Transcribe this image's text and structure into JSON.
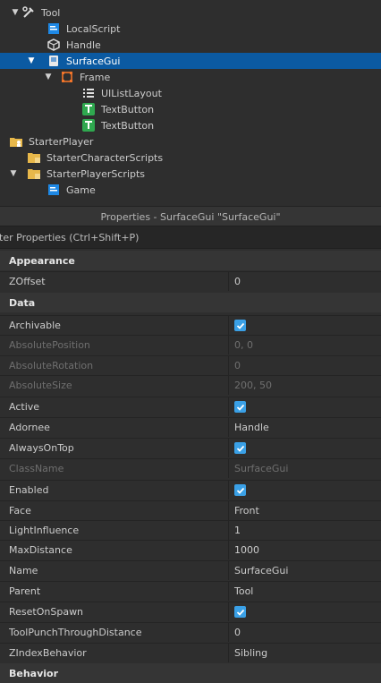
{
  "explorer": {
    "items": [
      {
        "label": "Tool",
        "icon": "tool-icon",
        "expanded": true
      },
      {
        "label": "LocalScript",
        "icon": "localscript-icon"
      },
      {
        "label": "Handle",
        "icon": "part-icon"
      },
      {
        "label": "SurfaceGui",
        "icon": "surfacegui-icon",
        "expanded": true,
        "selected": true
      },
      {
        "label": "Frame",
        "icon": "frame-icon",
        "expanded": true
      },
      {
        "label": "UIListLayout",
        "icon": "list-layout-icon"
      },
      {
        "label": "TextButton",
        "icon": "textbutton-icon"
      },
      {
        "label": "TextButton",
        "icon": "textbutton-icon"
      },
      {
        "label": "StarterPlayer",
        "icon": "starterplayer-icon"
      },
      {
        "label": "StarterCharacterScripts",
        "icon": "folder-icon"
      },
      {
        "label": "StarterPlayerScripts",
        "icon": "folder-icon",
        "expanded": true
      },
      {
        "label": "Game",
        "icon": "localscript-icon"
      }
    ]
  },
  "properties": {
    "title": "Properties - SurfaceGui \"SurfaceGui\"",
    "filter_placeholder": "lter Properties (Ctrl+Shift+P)",
    "sections": [
      {
        "name": "Appearance"
      },
      {
        "name": "Data"
      },
      {
        "name": "Behavior"
      }
    ],
    "rows": [
      {
        "name": "ZOffset",
        "value": "0"
      },
      {
        "name": "Archivable",
        "checked": true
      },
      {
        "name": "AbsolutePosition",
        "value": "0, 0",
        "disabled": true
      },
      {
        "name": "AbsoluteRotation",
        "value": "0",
        "disabled": true
      },
      {
        "name": "AbsoluteSize",
        "value": "200, 50",
        "disabled": true
      },
      {
        "name": "Active",
        "checked": true
      },
      {
        "name": "Adornee",
        "value": "Handle"
      },
      {
        "name": "AlwaysOnTop",
        "checked": true
      },
      {
        "name": "ClassName",
        "value": "SurfaceGui",
        "disabled": true
      },
      {
        "name": "Enabled",
        "checked": true
      },
      {
        "name": "Face",
        "value": "Front"
      },
      {
        "name": "LightInfluence",
        "value": "1"
      },
      {
        "name": "MaxDistance",
        "value": "1000"
      },
      {
        "name": "Name",
        "value": "SurfaceGui"
      },
      {
        "name": "Parent",
        "value": "Tool"
      },
      {
        "name": "ResetOnSpawn",
        "checked": true
      },
      {
        "name": "ToolPunchThroughDistance",
        "value": "0"
      },
      {
        "name": "ZIndexBehavior",
        "value": "Sibling"
      }
    ]
  },
  "colors": {
    "selection": "#0b5aa2",
    "checkbox": "#3aa0e6",
    "background": "#2e2e2e"
  }
}
